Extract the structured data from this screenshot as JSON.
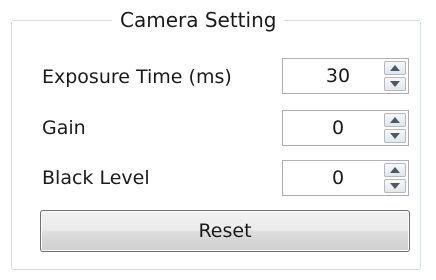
{
  "group": {
    "title": "Camera Setting"
  },
  "fields": [
    {
      "label": "Exposure Time (ms)",
      "value": "30"
    },
    {
      "label": "Gain",
      "value": "0"
    },
    {
      "label": "Black Level",
      "value": "0"
    }
  ],
  "reset_label": "Reset",
  "colors": {
    "group_border": "#d5dfe5",
    "text": "#1a1a1a",
    "spin_border": "#abadb3"
  }
}
